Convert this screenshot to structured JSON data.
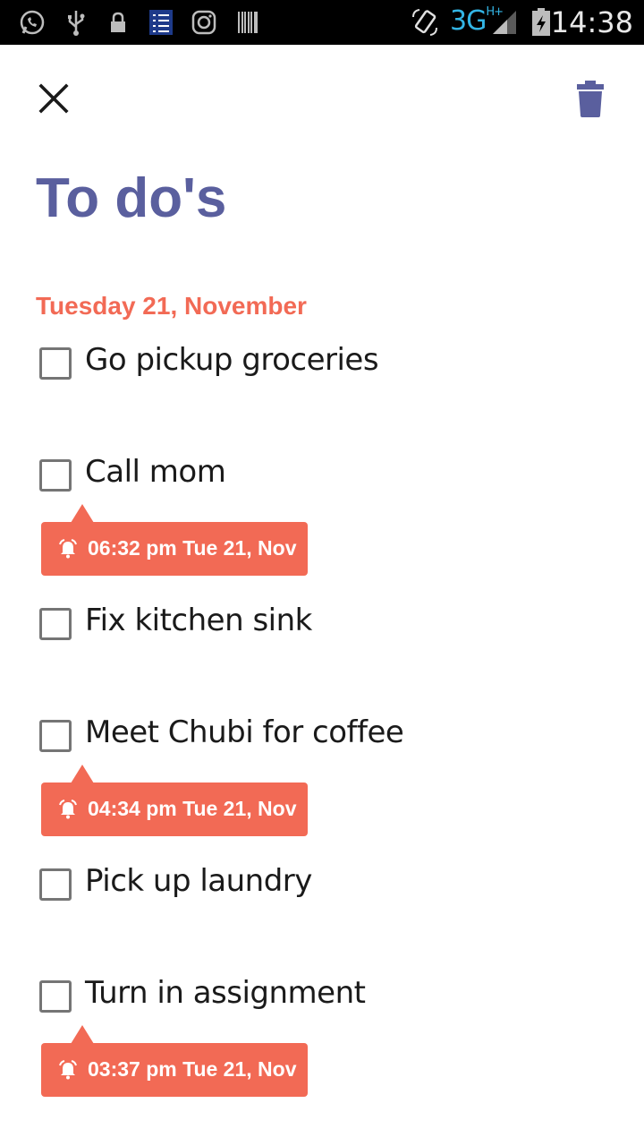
{
  "status_bar": {
    "network": "3G",
    "network_sub": "H+",
    "time": "14:38",
    "icons": [
      "whatsapp-icon",
      "usb-icon",
      "lock-icon",
      "checklist-app-icon",
      "instagram-icon",
      "barcode-icon",
      "rotate-icon",
      "signal-icon",
      "battery-icon"
    ]
  },
  "toolbar": {
    "close_icon": "close-icon",
    "delete_icon": "trash-icon"
  },
  "page": {
    "title": "To do's",
    "date_header": "Tuesday 21, November"
  },
  "tasks": [
    {
      "label": "Go pickup groceries",
      "checked": false,
      "reminder": null
    },
    {
      "label": "Call mom",
      "checked": false,
      "reminder": "06:32 pm Tue 21, Nov"
    },
    {
      "label": "Fix kitchen sink",
      "checked": false,
      "reminder": null
    },
    {
      "label": "Meet Chubi for coffee",
      "checked": false,
      "reminder": "04:34 pm Tue 21, Nov"
    },
    {
      "label": "Pick up laundry",
      "checked": false,
      "reminder": null
    },
    {
      "label": "Turn in assignment",
      "checked": false,
      "reminder": "03:37 pm Tue 21, Nov"
    }
  ],
  "colors": {
    "accent": "#5a5f9e",
    "reminder": "#f26a55",
    "status_bar": "#000000",
    "network": "#33b5e5"
  }
}
